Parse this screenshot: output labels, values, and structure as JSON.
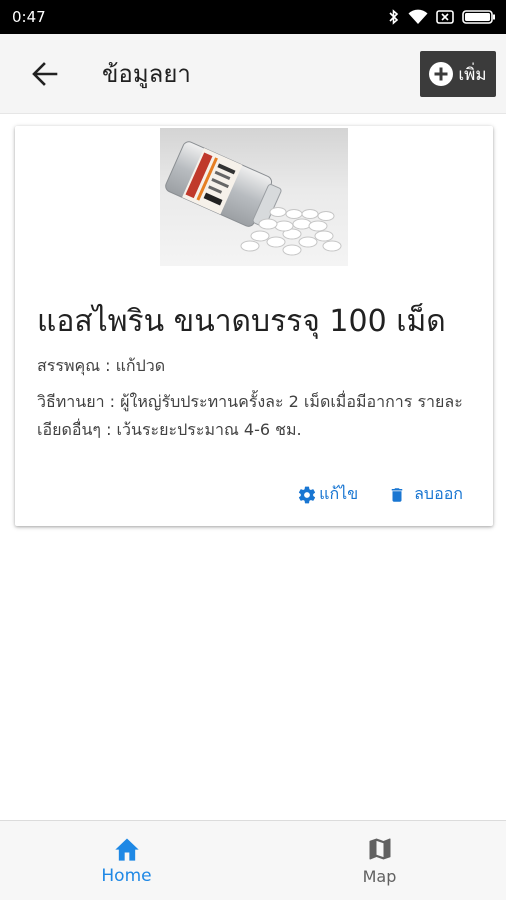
{
  "status_bar": {
    "time": "0:47"
  },
  "app_bar": {
    "title": "ข้อมูลยา",
    "add_label": "เพิ่ม"
  },
  "medicine": {
    "title": "แอสไพริน ขนาดบรรจุ 100 เม็ด",
    "property": "สรรพคุณ : แก้ปวด",
    "usage": "วิธีทานยา : ผู้ใหญ่รับประทานครั้งละ 2 เม็ดเมื่อมีอาการ รายละเอียดอื่นๆ : เว้นระยะประมาณ 4-6 ชม.",
    "edit_label": "แก้ไข",
    "delete_label": "ลบออก"
  },
  "bottom_nav": {
    "items": [
      {
        "label": "Home",
        "icon": "home-icon",
        "active": true
      },
      {
        "label": "Map",
        "icon": "map-icon",
        "active": false
      }
    ]
  },
  "colors": {
    "accent": "#1e88e5",
    "action": "#1976d2",
    "app_bar_bg": "#f5f5f5",
    "add_button_bg": "#3b3b3b"
  }
}
